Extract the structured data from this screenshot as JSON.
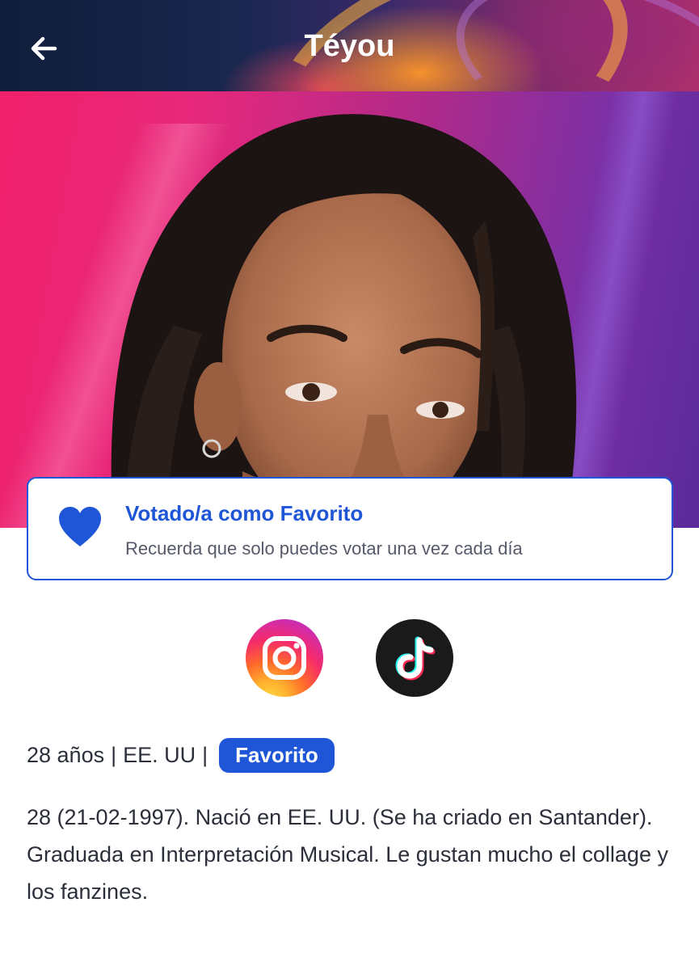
{
  "header": {
    "title": "Téyou",
    "back_icon": "arrow-left-icon"
  },
  "vote_card": {
    "icon": "heart-icon",
    "title": "Votado/a como Favorito",
    "subtitle": "Recuerda que solo puedes votar una vez cada día"
  },
  "socials": [
    {
      "icon": "instagram-icon"
    },
    {
      "icon": "tiktok-icon"
    }
  ],
  "info": {
    "age": "28 años",
    "separator1": "|",
    "country": "EE. UU",
    "separator2": "|",
    "badge": "Favorito"
  },
  "bio": "28 (21-02-1997). Nació en EE. UU. (Se ha criado en Santander). Graduada en Interpretación Musical. Le gustan mucho el collage y los fanzines.",
  "colors": {
    "accent": "#1f56d8",
    "text": "#2b2f3a",
    "muted": "#55596a"
  }
}
